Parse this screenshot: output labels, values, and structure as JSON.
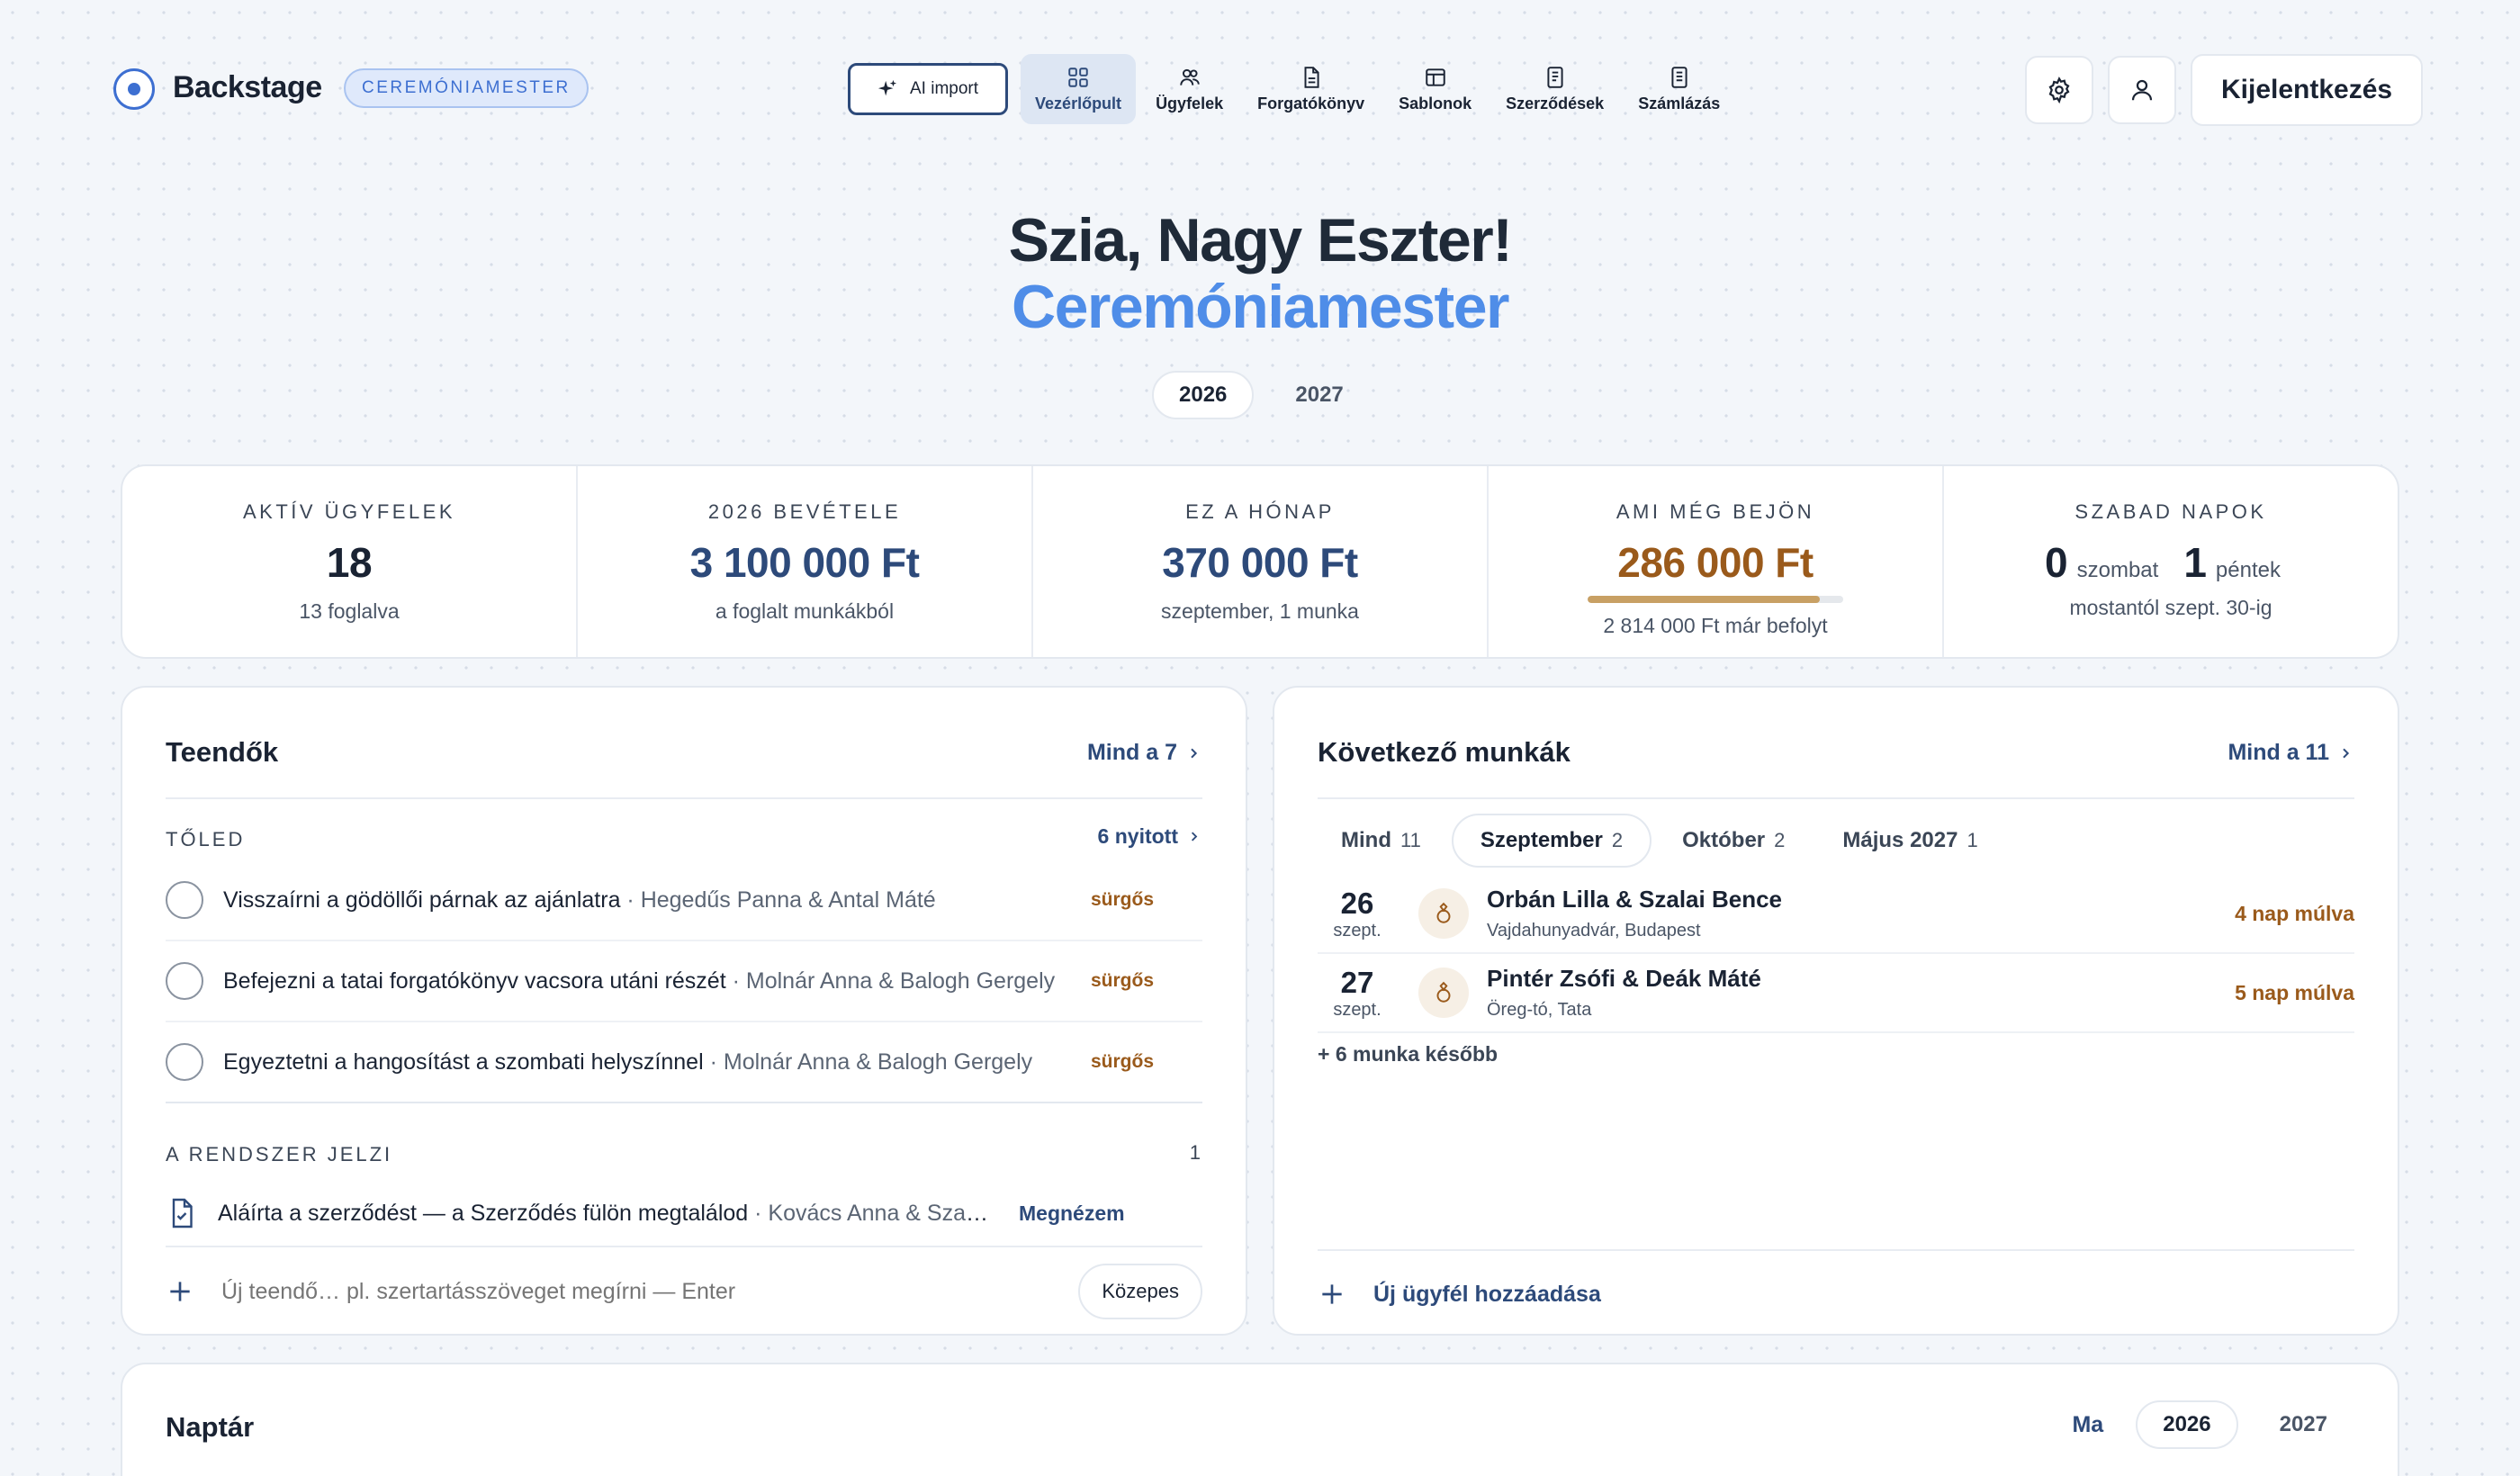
{
  "header": {
    "brand": "Backstage",
    "role": "CEREMÓNIAMESTER",
    "ai_import": "AI import",
    "nav": [
      "Vezérlőpult",
      "Ügyfelek",
      "Forgatókönyv",
      "Sablonok",
      "Szerződések",
      "Számlázás"
    ],
    "active_nav": "Vezérlőpult",
    "logout": "Kijelentkezés"
  },
  "hero": {
    "greeting": "Szia, Nagy Eszter!",
    "role": "Ceremóniamester",
    "years": [
      "2026",
      "2027"
    ],
    "active_year": "2026"
  },
  "stats": {
    "active_clients": {
      "label": "AKTÍV ÜGYFELEK",
      "value": "18",
      "sub": "13 foglalva"
    },
    "revenue": {
      "label": "2026 BEVÉTELE",
      "value": "3 100 000 Ft",
      "sub": "a foglalt munkákból"
    },
    "this_month": {
      "label": "EZ A HÓNAP",
      "value": "370 000 Ft",
      "sub": "szeptember, 1 munka"
    },
    "incoming": {
      "label": "AMI MÉG BEJÖN",
      "value": "286 000 Ft",
      "sub": "2 814 000 Ft már befolyt",
      "progress": 0.91
    },
    "free_days": {
      "label": "SZABAD NAPOK",
      "saturday_count": "0",
      "saturday_label": "szombat",
      "friday_count": "1",
      "friday_label": "péntek",
      "sub": "mostantól szept. 30-ig"
    }
  },
  "todos": {
    "title": "Teendők",
    "all_link": "Mind a 7",
    "from_you_label": "TŐLED",
    "open_link": "6 nyitott",
    "items": [
      {
        "text": "Visszaírni a gödöllői párnak az ajánlatra",
        "meta": "· Hegedűs Panna & Antal Máté",
        "tag": "sürgős"
      },
      {
        "text": "Befejezni a tatai forgatókönyv vacsora utáni részét",
        "meta": "· Molnár Anna & Balogh Gergely",
        "tag": "sürgős"
      },
      {
        "text": "Egyeztetni a hangosítást a szombati helyszínnel",
        "meta": "· Molnár Anna & Balogh Gergely",
        "tag": "sürgős"
      }
    ],
    "system_label": "A RENDSZER JELZI",
    "system_count": "1",
    "system_item": {
      "text": "Aláírta a szerződést — a Szerződés fülön megtalálod",
      "meta": "· Kovács Anna & Szabó Péter",
      "action": "Megnézem"
    },
    "new_placeholder": "Új teendő… pl. szertartásszöveget megírni — Enter",
    "priority": "Közepes"
  },
  "jobs": {
    "title": "Következő munkák",
    "all_link": "Mind a 11",
    "tabs": [
      {
        "label": "Mind",
        "count": "11"
      },
      {
        "label": "Szeptember",
        "count": "2"
      },
      {
        "label": "Október",
        "count": "2"
      },
      {
        "label": "Május 2027",
        "count": "1"
      }
    ],
    "active_tab": "Szeptember",
    "items": [
      {
        "day": "26",
        "month": "szept.",
        "name": "Orbán Lilla & Szalai Bence",
        "place": "Vajdahunyadvár, Budapest",
        "when": "4 nap múlva"
      },
      {
        "day": "27",
        "month": "szept.",
        "name": "Pintér Zsófi & Deák Máté",
        "place": "Öreg-tó, Tata",
        "when": "5 nap múlva"
      }
    ],
    "more": "+ 6 munka később",
    "add_client": "Új ügyfél hozzáadása"
  },
  "calendar": {
    "title": "Naptár",
    "today": "Ma",
    "years": [
      "2026",
      "2027"
    ],
    "active_year": "2026"
  },
  "colors": {
    "accent": "#4f8de8",
    "navy": "#2d4a7a",
    "gold": "#9a5a1b"
  }
}
